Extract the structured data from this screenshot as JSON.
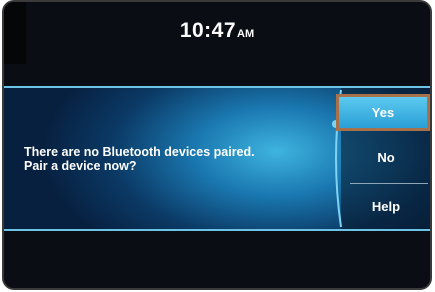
{
  "status": {
    "time": "10:47",
    "ampm": "AM"
  },
  "dialog": {
    "message_line1": "There are no Bluetooth devices paired.",
    "message_line2": "Pair a device now?"
  },
  "options": {
    "yes": "Yes",
    "no": "No",
    "help": "Help"
  },
  "colors": {
    "highlight": "#a7714c",
    "accent": "#2a9fd6",
    "background": "#0a0e14"
  }
}
